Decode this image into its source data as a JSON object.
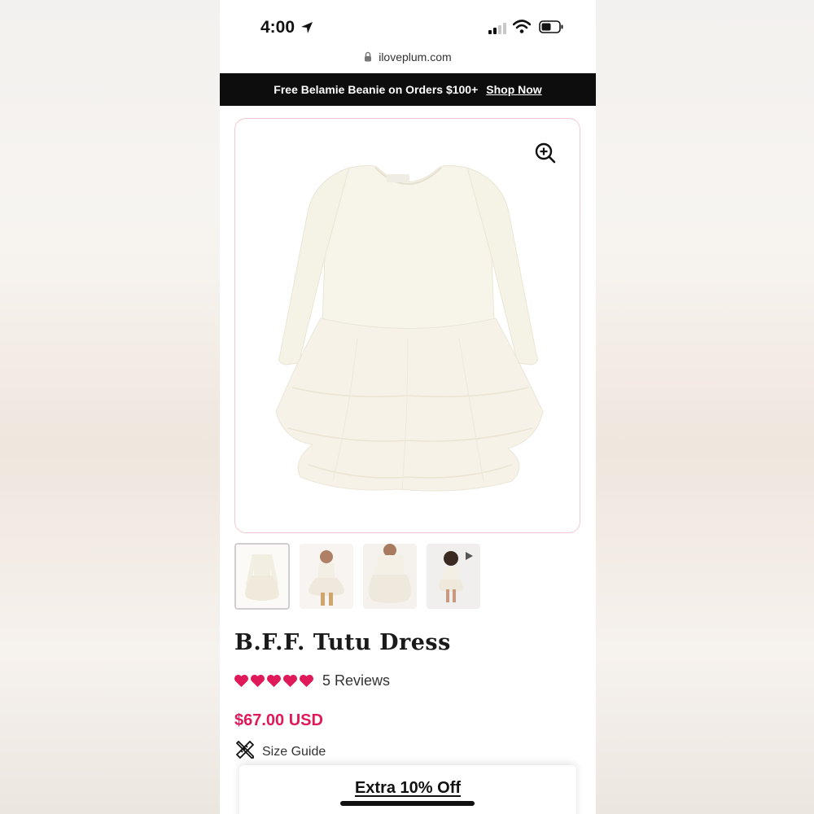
{
  "status_bar": {
    "time": "4:00",
    "icons": [
      "location-arrow-icon",
      "signal-icon",
      "wifi-icon",
      "battery-icon"
    ]
  },
  "browser": {
    "url": "iloveplum.com",
    "lock_icon": "lock-icon"
  },
  "promo": {
    "text": "Free Belamie Beanie on Orders $100+",
    "link_label": "Shop Now"
  },
  "product": {
    "title": "B.F.F. Tutu Dress",
    "rating_hearts": 5,
    "heart_color": "#e0195a",
    "reviews_label": "5 Reviews",
    "price": "$67.00 USD",
    "size_guide_label": "Size Guide",
    "zoom_icon": "zoom-in-icon",
    "thumbnail_count": 4,
    "video_thumbnail_icon": "play-icon"
  },
  "popup": {
    "title": "Extra 10% Off"
  },
  "colors": {
    "accent": "#e0195a",
    "promo_bg": "#0d0d0d",
    "image_border": "#f3c9d1"
  }
}
